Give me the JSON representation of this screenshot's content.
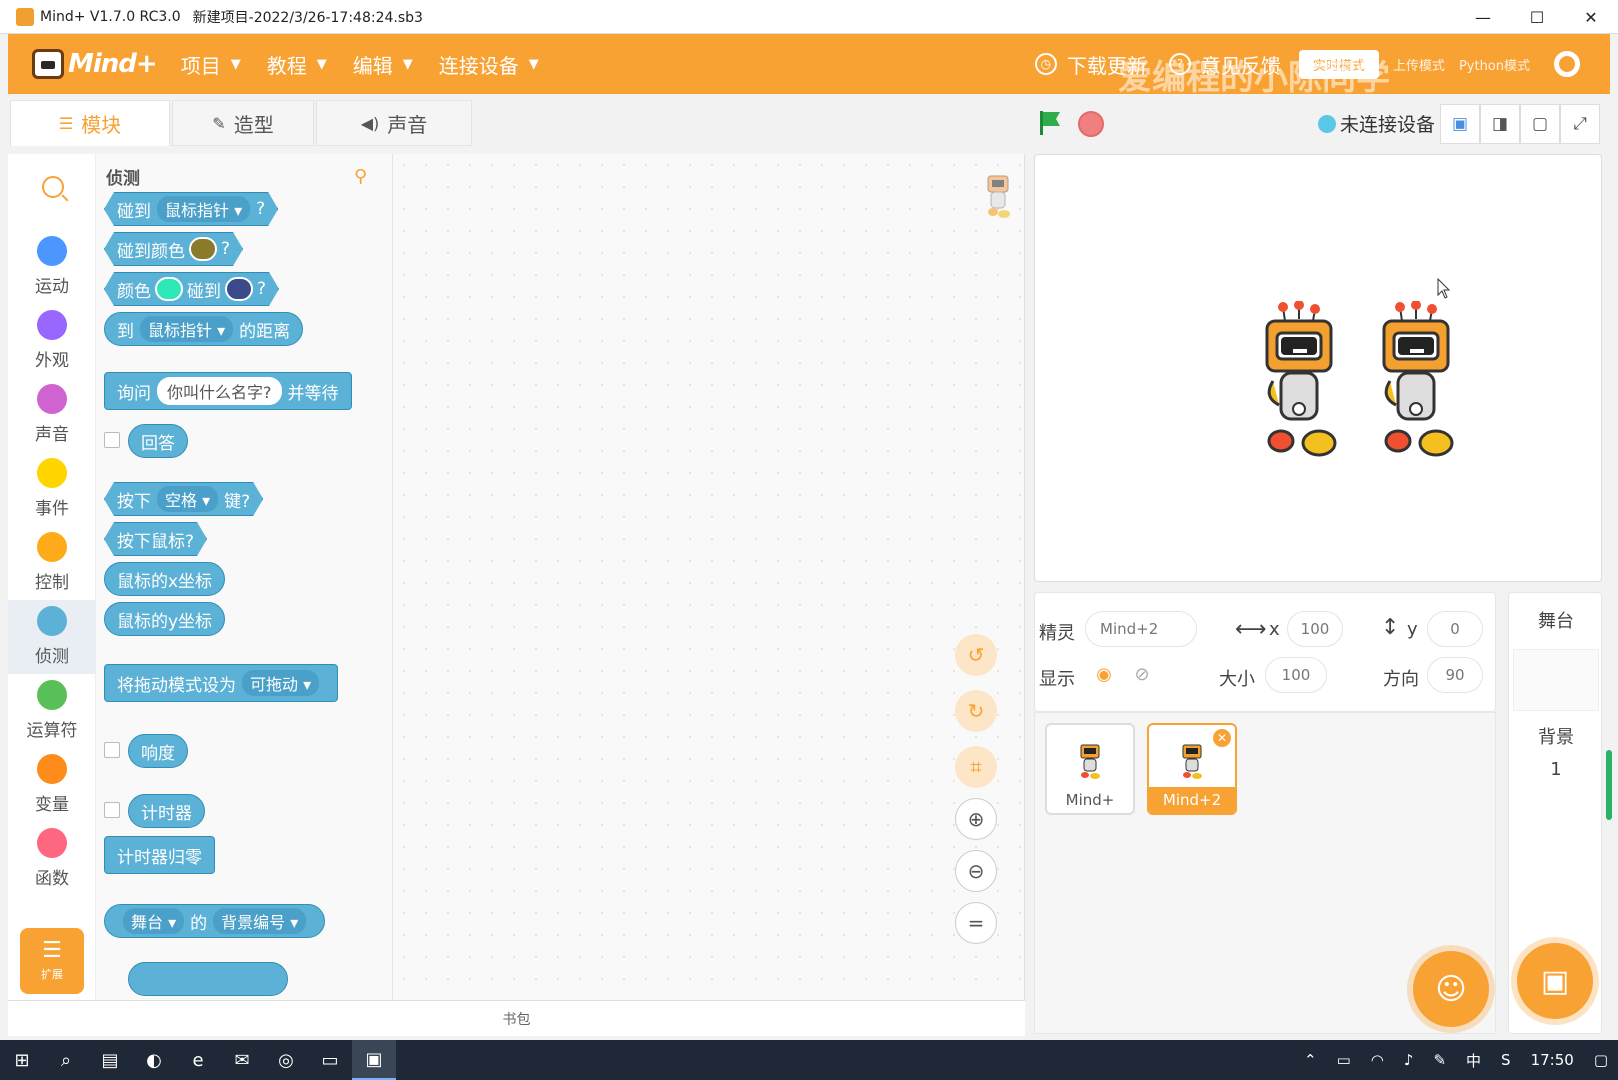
{
  "window": {
    "app_title": "Mind+ V1.7.0 RC3.0",
    "project_title": "新建项目-2022/3/26-17:48:24.sb3",
    "minimize": "—",
    "maximize": "☐",
    "close": "✕"
  },
  "menubar": {
    "logo": "Mind+",
    "items": [
      {
        "label": "项目"
      },
      {
        "label": "教程"
      },
      {
        "label": "编辑"
      },
      {
        "label": "连接设备"
      }
    ],
    "download_update": "下载更新",
    "feedback": "意见反馈",
    "mode_realtime": "实时模式",
    "mode_upload": "上传模式",
    "mode_python": "Python模式",
    "watermark": "爱编程的小陈同学"
  },
  "tabs": [
    {
      "label": "模块",
      "icon": "blocks-icon"
    },
    {
      "label": "造型",
      "icon": "brush-icon"
    },
    {
      "label": "声音",
      "icon": "speaker-icon"
    }
  ],
  "device_status": "未连接设备",
  "categories": [
    {
      "label": "运动",
      "color": "#4c97ff"
    },
    {
      "label": "外观",
      "color": "#9966ff"
    },
    {
      "label": "声音",
      "color": "#cf63cf"
    },
    {
      "label": "事件",
      "color": "#ffd500"
    },
    {
      "label": "控制",
      "color": "#ffab19"
    },
    {
      "label": "侦测",
      "color": "#5cb1d6"
    },
    {
      "label": "运算符",
      "color": "#59c059"
    },
    {
      "label": "变量",
      "color": "#ff8c1a"
    },
    {
      "label": "函数",
      "color": "#ff6680"
    }
  ],
  "extensions_label": "扩展",
  "palette": {
    "heading": "侦测",
    "touching": {
      "a": "碰到",
      "b": "鼠标指针",
      "c": "?"
    },
    "touching_color": {
      "a": "碰到颜色",
      "c": "?",
      "swatch": "#8a7a2a"
    },
    "color_touching": {
      "a": "颜色",
      "b": "碰到",
      "c": "?",
      "swatch1": "#2ee8b8",
      "swatch2": "#3b4a8a"
    },
    "distance": {
      "a": "到",
      "b": "鼠标指针",
      "c": "的距离"
    },
    "ask": {
      "a": "询问",
      "b": "你叫什么名字?",
      "c": "并等待"
    },
    "answer": "回答",
    "key_pressed": {
      "a": "按下",
      "b": "空格",
      "c": "键?"
    },
    "mouse_down": "按下鼠标?",
    "mouse_x": "鼠标的x坐标",
    "mouse_y": "鼠标的y坐标",
    "drag_mode": {
      "a": "将拖动模式设为",
      "b": "可拖动"
    },
    "loudness": "响度",
    "timer": "计时器",
    "reset_timer": "计时器归零",
    "backdrop": {
      "a": "舞台",
      "b": "的",
      "c": "背景编号"
    }
  },
  "backpack": "书包",
  "sprite_info": {
    "sprite_label": "精灵",
    "sprite_name": "Mind+2",
    "x_label": "x",
    "x_value": "100",
    "y_label": "y",
    "y_value": "0",
    "show_label": "显示",
    "size_label": "大小",
    "size_value": "100",
    "direction_label": "方向",
    "direction_value": "90"
  },
  "sprites": [
    {
      "name": "Mind+"
    },
    {
      "name": "Mind+2"
    }
  ],
  "stage_panel": {
    "title": "舞台",
    "backdrops_label": "背景",
    "backdrop_count": "1"
  },
  "taskbar": {
    "time": "17:50",
    "ime": "中"
  }
}
